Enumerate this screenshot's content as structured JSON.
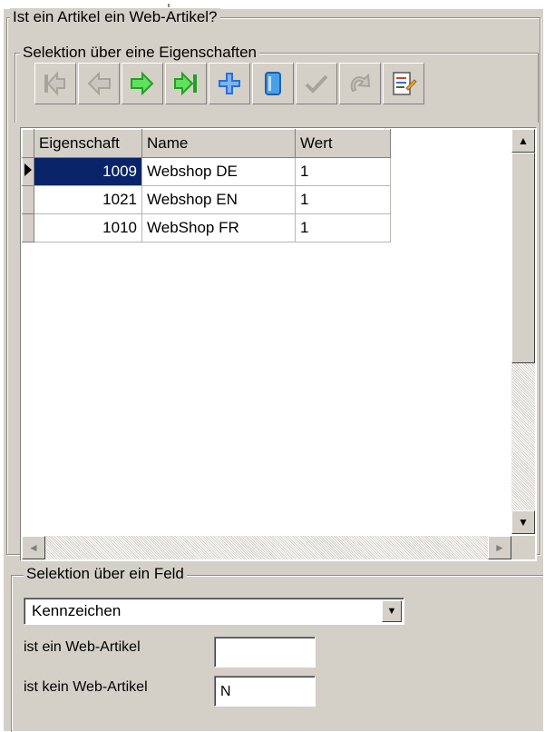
{
  "outer_group": {
    "title": "Ist ein Artikel ein Web-Artikel?"
  },
  "property_group": {
    "title": "Selektion über eine Eigenschaften"
  },
  "toolbar": {
    "buttons": [
      {
        "name": "first-record-button",
        "icon": "first-icon"
      },
      {
        "name": "prior-record-button",
        "icon": "prior-icon"
      },
      {
        "name": "next-record-button",
        "icon": "next-icon"
      },
      {
        "name": "last-record-button",
        "icon": "last-icon"
      },
      {
        "name": "insert-record-button",
        "icon": "plus-icon"
      },
      {
        "name": "delete-record-button",
        "icon": "delete-icon"
      },
      {
        "name": "post-record-button",
        "icon": "check-icon"
      },
      {
        "name": "cancel-edit-button",
        "icon": "undo-icon"
      },
      {
        "name": "edit-properties-button",
        "icon": "properties-icon"
      }
    ]
  },
  "grid": {
    "columns": [
      "Eigenschaft",
      "Name",
      "Wert"
    ],
    "rows": [
      {
        "eigenschaft": "1009",
        "name": "Webshop DE",
        "wert": "1",
        "selected": true
      },
      {
        "eigenschaft": "1021",
        "name": "Webshop EN",
        "wert": "1",
        "selected": false
      },
      {
        "eigenschaft": "1010",
        "name": "WebShop FR",
        "wert": "1",
        "selected": false
      }
    ]
  },
  "field_group": {
    "title": "Selektion über ein Feld"
  },
  "field_select": {
    "value": "Kennzeichen"
  },
  "is_web": {
    "label": "ist ein Web-Artikel",
    "value": ""
  },
  "is_not_web": {
    "label": "ist kein Web-Artikel",
    "value": "N"
  },
  "colors": {
    "panel": "#d4d0c8",
    "selection": "#0a246a",
    "arrow_green": "#3cc23c",
    "arrow_gray": "#a8a49c",
    "plus_blue": "#2a6fd6"
  }
}
